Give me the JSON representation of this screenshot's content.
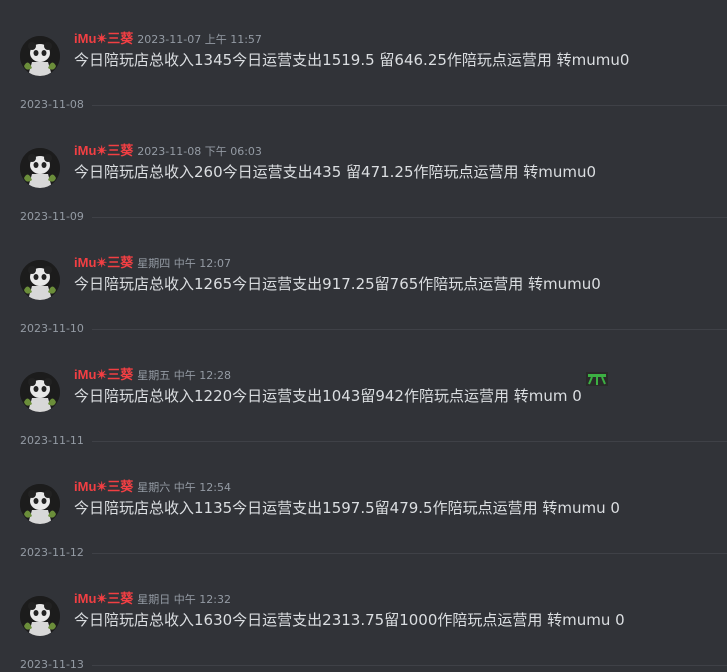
{
  "colors": {
    "background": "#313338",
    "author": "#f23f43",
    "text": "#dbdee1",
    "muted": "#949ba4",
    "divider": "#3f4147"
  },
  "messages": [
    {
      "author": "iMu✴三葵",
      "timestamp": "2023-11-07 上午 11:57",
      "content": "今日陪玩店总收入1345今日运营支出1519.5 留646.25作陪玩点运营用 转mumu0"
    },
    {
      "author": "iMu✴三葵",
      "timestamp": "2023-11-08 下午 06:03",
      "content": "今日陪玩店总收入260今日运营支出435 留471.25作陪玩点运营用 转mumu0"
    },
    {
      "author": "iMu✴三葵",
      "timestamp": "星期四 中午 12:07",
      "content": "今日陪玩店总收入1265今日运营支出917.25留765作陪玩点运营用 转mumu0"
    },
    {
      "author": "iMu✴三葵",
      "timestamp": "星期五 中午 12:28",
      "content": "今日陪玩店总收入1220今日运营支出1043留942作陪玩点运营用 转mum 0"
    },
    {
      "author": "iMu✴三葵",
      "timestamp": "星期六 中午 12:54",
      "content": "今日陪玩店总收入1135今日运营支出1597.5留479.5作陪玩点运营用 转mumu 0"
    },
    {
      "author": "iMu✴三葵",
      "timestamp": "星期日 中午 12:32",
      "content": "今日陪玩店总收入1630今日运营支出2313.75留1000作陪玩点运营用 转mumu 0"
    }
  ],
  "dividers": [
    "2023-11-08",
    "2023-11-09",
    "2023-11-10",
    "2023-11-11",
    "2023-11-12",
    "2023-11-13"
  ],
  "icons": {
    "avatar": "panda-avatar-icon",
    "reaction": "green-emoji-icon"
  }
}
